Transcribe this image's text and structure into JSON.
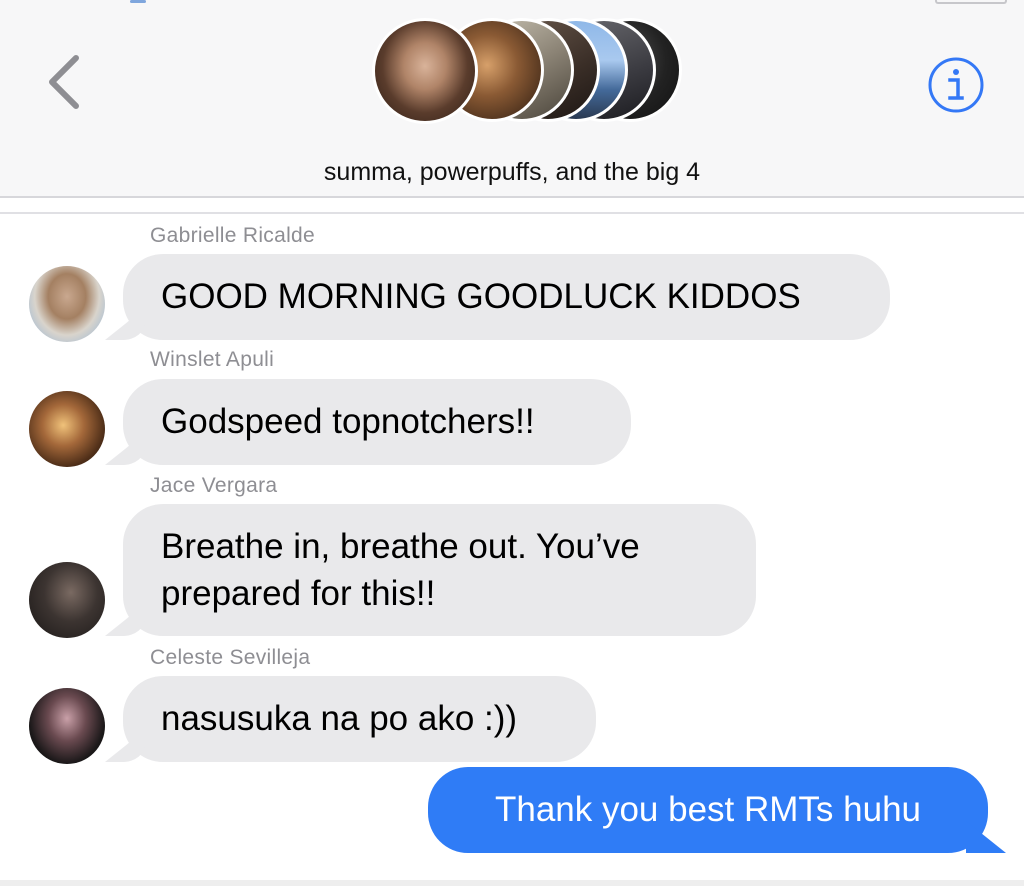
{
  "header": {
    "title": "summa, powerpuffs, and the big 4",
    "back_icon": "chevron-left-icon",
    "info_icon": "info-circle-icon",
    "accent_color": "#3478f6"
  },
  "messages": [
    {
      "sender": "Gabrielle Ricalde",
      "text": "GOOD MORNING GOODLUCK KIDDOS",
      "direction": "received"
    },
    {
      "sender": "Winslet Apuli",
      "text": "Godspeed topnotchers!!",
      "direction": "received"
    },
    {
      "sender": "Jace Vergara",
      "text": "Breathe in, breathe out. You’ve\nprepared for this!!",
      "direction": "received"
    },
    {
      "sender": "Celeste Sevilleja",
      "text": "nasusuka na po ako :))",
      "direction": "received"
    },
    {
      "sender": "",
      "text": "Thank you best RMTs huhu",
      "direction": "sent"
    }
  ],
  "colors": {
    "received_bubble": "#e9e9eb",
    "sent_bubble": "#2f7cf6",
    "sender_name": "#8e8e93"
  }
}
